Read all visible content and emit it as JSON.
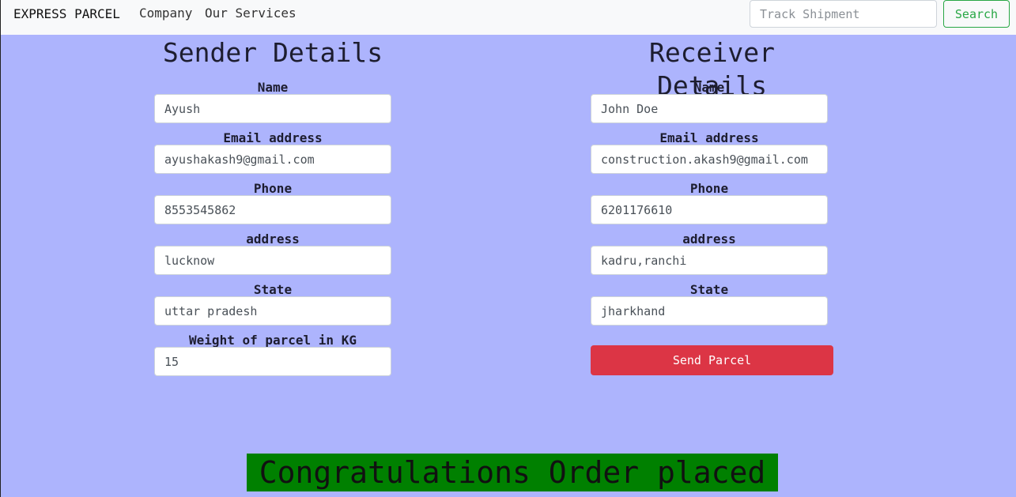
{
  "navbar": {
    "brand": "EXPRESS PARCEL",
    "links": [
      "Company",
      "Our Services"
    ],
    "search_placeholder": "Track Shipment",
    "search_button": "Search"
  },
  "sender": {
    "heading": "Sender Details",
    "name_label": "Name",
    "name_value": "Ayush",
    "email_label": "Email address",
    "email_value": "ayushakash9@gmail.com",
    "phone_label": "Phone",
    "phone_value": "8553545862",
    "address_label": "address",
    "address_value": "lucknow",
    "state_label": "State",
    "state_value": "uttar pradesh",
    "weight_label": "Weight of parcel in KG",
    "weight_value": "15"
  },
  "receiver": {
    "heading": "Receiver Details",
    "name_label": "Name",
    "name_value": "John Doe",
    "email_label": "Email address",
    "email_value": "construction.akash9@gmail.com",
    "phone_label": "Phone",
    "phone_value": "6201176610",
    "address_label": "address",
    "address_value": "kadru,ranchi",
    "state_label": "State",
    "state_value": "jharkhand",
    "send_button": "Send Parcel"
  },
  "message": "Congratulations Order placed",
  "colors": {
    "background": "#adb4fd",
    "send_button": "#dc3545",
    "search_button": "#28a745",
    "message_bg": "#008000"
  }
}
